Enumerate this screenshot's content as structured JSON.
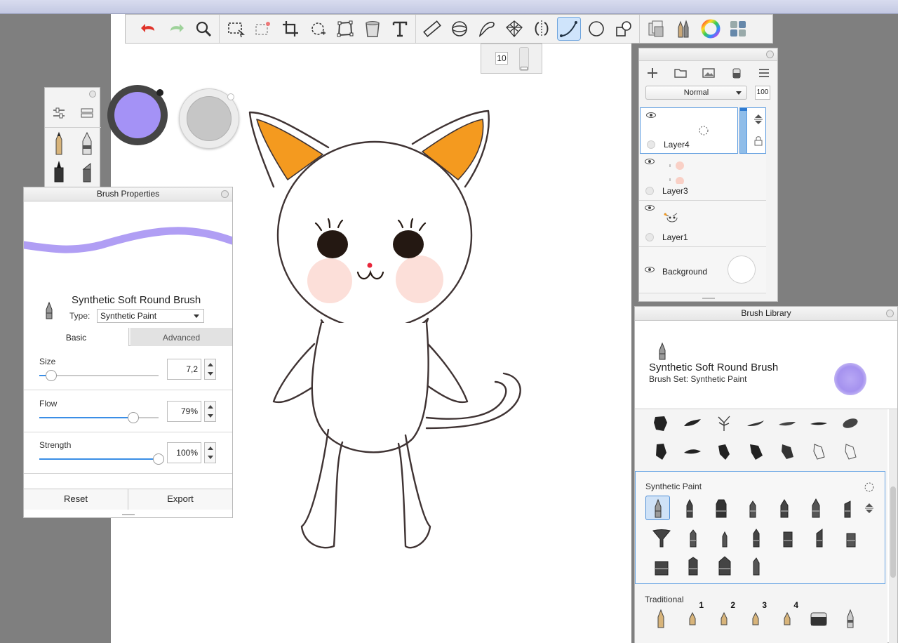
{
  "toolbar": {
    "tools": [
      {
        "name": "undo-icon"
      },
      {
        "name": "redo-icon"
      },
      {
        "name": "magnifier-icon"
      },
      {
        "name": "select-rect-icon"
      },
      {
        "name": "select-clear-icon"
      },
      {
        "name": "crop-icon"
      },
      {
        "name": "transform-icon"
      },
      {
        "name": "distort-icon"
      },
      {
        "name": "fill-bucket-icon"
      },
      {
        "name": "text-icon"
      },
      {
        "name": "ruler-icon"
      },
      {
        "name": "ellipse-guide-icon"
      },
      {
        "name": "french-curve-icon"
      },
      {
        "name": "perspective-icon"
      },
      {
        "name": "symmetry-icon"
      },
      {
        "name": "stroke-curve-icon"
      },
      {
        "name": "circle-shape-icon"
      },
      {
        "name": "shape-icon"
      },
      {
        "name": "copy-layers-icon"
      },
      {
        "name": "brushes-icon"
      },
      {
        "name": "color-wheel-icon"
      },
      {
        "name": "grid-menu-icon"
      }
    ],
    "active_tool": "stroke-curve-icon",
    "size_value": "10"
  },
  "colors": {
    "current_color": "#a492f6",
    "secondary_color": "#c6c6c6",
    "accent": "#3a8ee6"
  },
  "brush_properties": {
    "title": "Brush Properties",
    "brush_name": "Synthetic Soft Round Brush",
    "type_label": "Type:",
    "type_value": "Synthetic Paint",
    "tabs": {
      "basic": "Basic",
      "advanced": "Advanced"
    },
    "size": {
      "label": "Size",
      "value": "7,2",
      "fraction": 0.1
    },
    "flow": {
      "label": "Flow",
      "value": "79%",
      "fraction": 0.79
    },
    "strength": {
      "label": "Strength",
      "value": "100%",
      "fraction": 1.0
    },
    "reset_label": "Reset",
    "export_label": "Export"
  },
  "layers": {
    "blend_mode": "Normal",
    "opacity": "100",
    "items": [
      {
        "name": "Layer4",
        "selected": true
      },
      {
        "name": "Layer3",
        "selected": false
      },
      {
        "name": "Layer1",
        "selected": false
      },
      {
        "name": "Background",
        "selected": false
      }
    ]
  },
  "brush_library": {
    "title": "Brush Library",
    "brush_name": "Synthetic Soft Round Brush",
    "brush_set": "Brush Set: Synthetic Paint",
    "group_label": "Synthetic Paint",
    "traditional_label": "Traditional",
    "traditional_numbers": [
      "1",
      "2",
      "3",
      "4"
    ]
  }
}
